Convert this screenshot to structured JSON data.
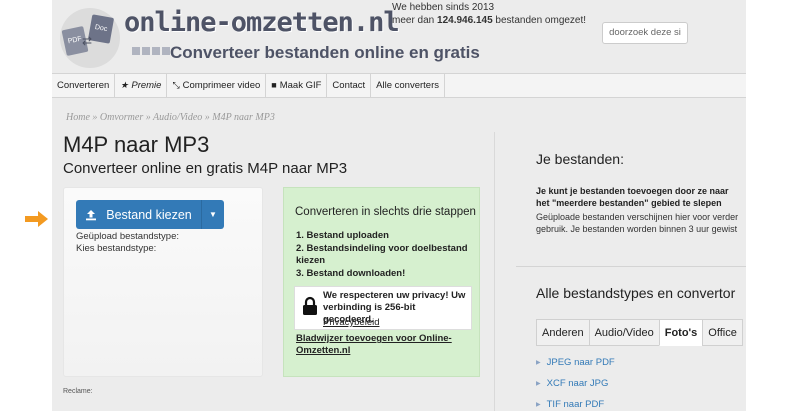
{
  "header": {
    "site_name": "online-omzetten.nl",
    "tagline": "Converteer bestanden online en gratis",
    "logo_pdf": "PDF",
    "logo_doc": "Doc",
    "stats_line1": "We hebben sinds 2013",
    "stats_prefix": "meer dan ",
    "stats_count": "124.946.145",
    "stats_suffix": " bestanden omgezet!",
    "search_label": "doorzoek deze si"
  },
  "nav": {
    "items": [
      {
        "label": "Converteren",
        "icon": ""
      },
      {
        "label": "Premie",
        "icon": "star-icon"
      },
      {
        "label": "Comprimeer video",
        "icon": "compress-icon"
      },
      {
        "label": "Maak GIF",
        "icon": "video-camera-icon"
      },
      {
        "label": "Contact",
        "icon": ""
      },
      {
        "label": "Alle converters",
        "icon": ""
      }
    ]
  },
  "breadcrumb": {
    "text": "Home » Omvormer » Audio/Video » M4P naar MP3"
  },
  "main": {
    "title": "M4P naar MP3",
    "subtitle": "Converteer online en gratis M4P naar MP3",
    "upload_button": "Bestand kiezen",
    "uploaded_label": "Geüpload bestandstype:",
    "choose_label": "Kies bestandstype:",
    "steps_title": "Converteren in slechts drie stappen",
    "steps": [
      "1. Bestand uploaden",
      "2. Bestandsindeling voor doelbestand kiezen",
      "3. Bestand downloaden!"
    ],
    "privacy_text": "We respecteren uw privacy! Uw verbinding is 256-bit gecodeerd.",
    "privacy_link": "Privacybeleid",
    "bookmark_link": "Bladwijzer toevoegen voor Online-Omzetten.nl",
    "reclame": "Reclame:"
  },
  "sidebar": {
    "files_title": "Je bestanden:",
    "files_bold": "Je kunt je bestanden toevoegen door ze naar het \"meerdere bestanden\" gebied te slepen",
    "files_text": "Geüploade bestanden verschijnen hier voor verder gebruik. Je bestanden worden binnen 3 uur gewist",
    "types_title": "Alle bestandstypes en convertor",
    "tabs": [
      {
        "label": "Anderen",
        "active": false
      },
      {
        "label": "Audio/Video",
        "active": false
      },
      {
        "label": "Foto's",
        "active": true
      },
      {
        "label": "Office",
        "active": false
      }
    ],
    "converters": [
      "JPEG naar PDF",
      "XCF naar JPG",
      "TIF naar PDF"
    ]
  },
  "colors": {
    "primary": "#337ab7",
    "arrow": "#f39a21",
    "steps_bg": "#d6f0cf",
    "link": "#337ab7"
  }
}
